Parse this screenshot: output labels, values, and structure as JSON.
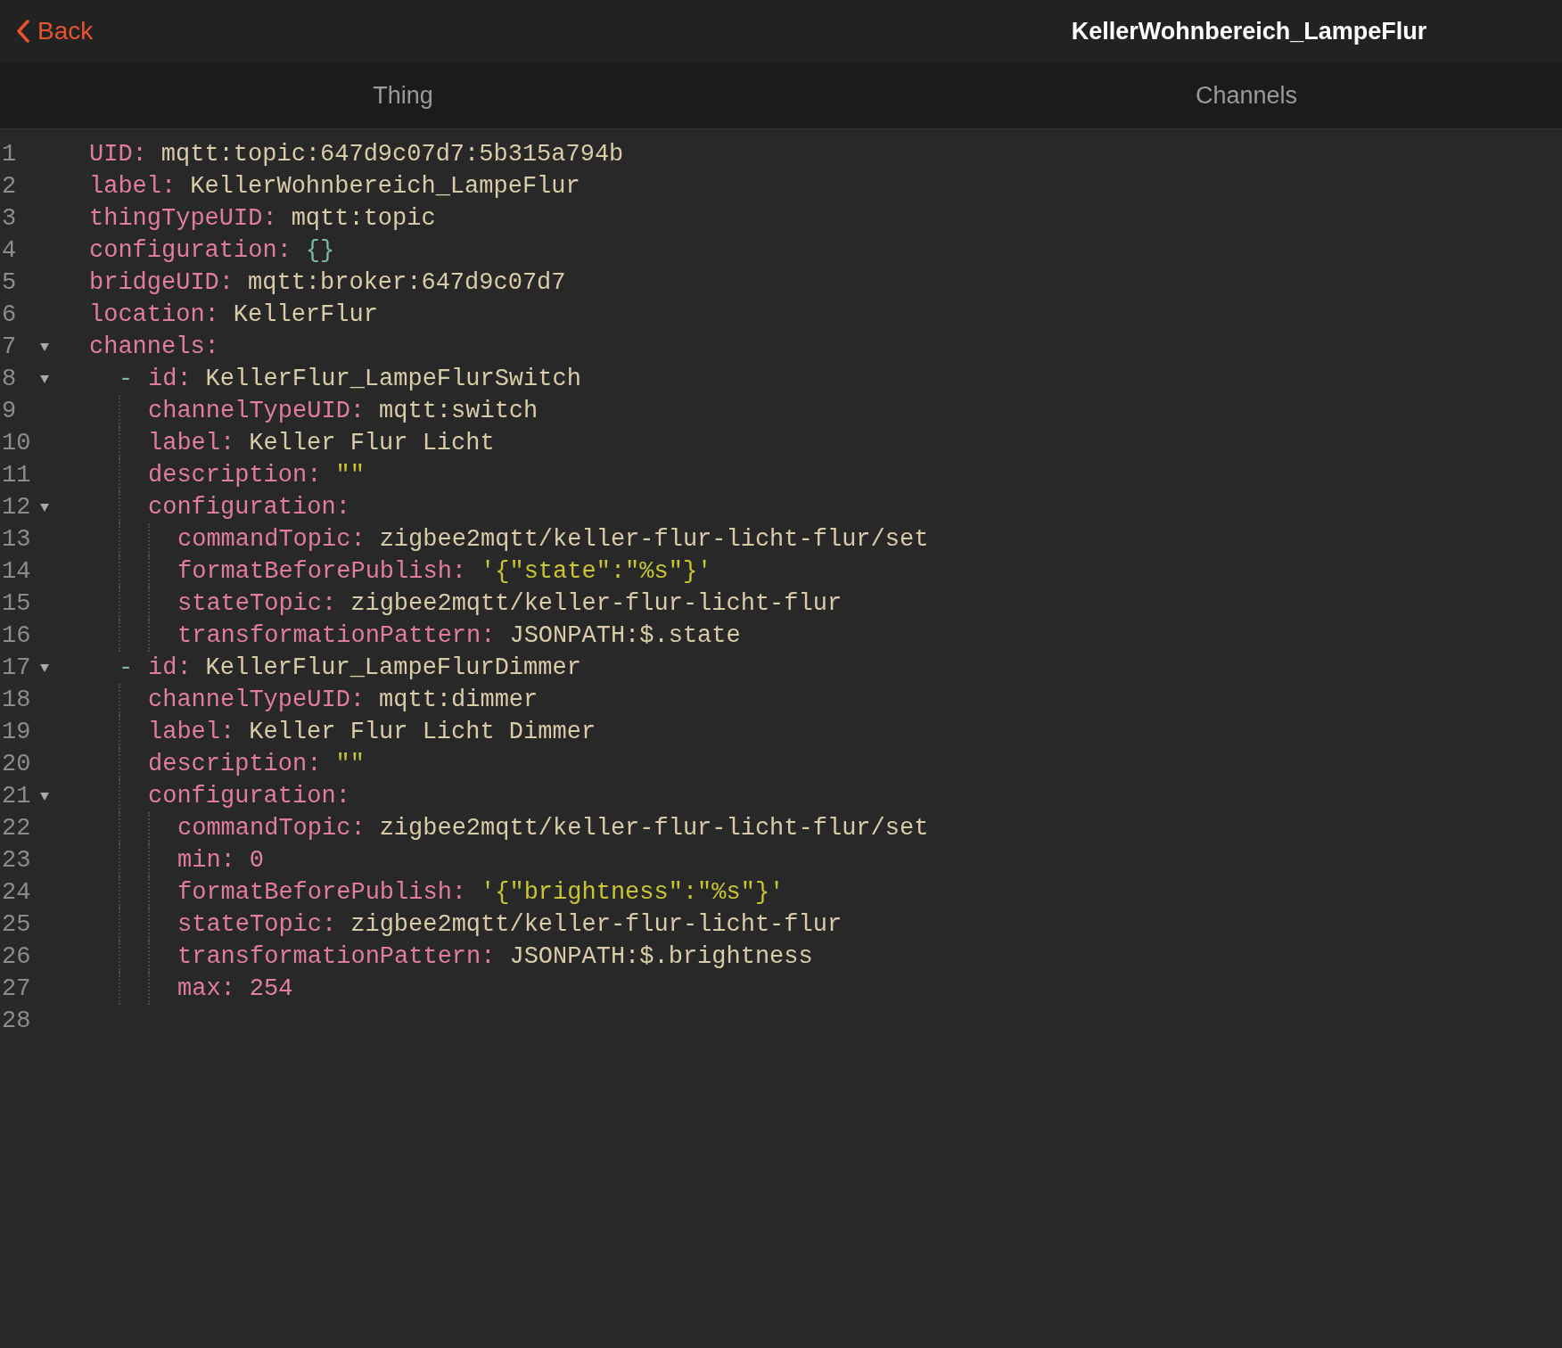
{
  "nav": {
    "back": "Back",
    "title": "KellerWohnbereich_LampeFlur"
  },
  "tabs": [
    {
      "label": "Thing"
    },
    {
      "label": "Channels"
    }
  ],
  "editor": {
    "lines": [
      {
        "number": "1",
        "key": "UID:",
        "value": "mqtt:topic:647d9c07d7:5b315a794b",
        "kind": "plain"
      },
      {
        "number": "2",
        "key": "label:",
        "value": "KellerWohnbereich_LampeFlur",
        "kind": "plain"
      },
      {
        "number": "3",
        "key": "thingTypeUID:",
        "value": "mqtt:topic",
        "kind": "plain"
      },
      {
        "number": "4",
        "key": "configuration:",
        "value": "{}",
        "kind": "brace"
      },
      {
        "number": "5",
        "key": "bridgeUID:",
        "value": "mqtt:broker:647d9c07d7",
        "kind": "plain"
      },
      {
        "number": "6",
        "key": "location:",
        "value": "KellerFlur",
        "kind": "plain"
      },
      {
        "number": "7",
        "key": "channels:",
        "expanded": true,
        "children": [
          {
            "number": "8",
            "marker": "-",
            "key": "id:",
            "value": "KellerFlur_LampeFlurSwitch",
            "kind": "plain",
            "expanded": true,
            "children": [
              {
                "number": "9",
                "key": "channelTypeUID:",
                "value": "mqtt:switch",
                "kind": "plain"
              },
              {
                "number": "10",
                "key": "label:",
                "value": "Keller Flur Licht",
                "kind": "plain"
              },
              {
                "number": "11",
                "key": "description:",
                "value": "\"\"",
                "kind": "string"
              },
              {
                "number": "12",
                "key": "configuration:",
                "expanded": true,
                "children": [
                  {
                    "number": "13",
                    "key": "commandTopic:",
                    "value": "zigbee2mqtt/keller-flur-licht-flur/set",
                    "kind": "plain"
                  },
                  {
                    "number": "14",
                    "key": "formatBeforePublish:",
                    "value": "'{\"state\":\"%s\"}'",
                    "kind": "string"
                  },
                  {
                    "number": "15",
                    "key": "stateTopic:",
                    "value": "zigbee2mqtt/keller-flur-licht-flur",
                    "kind": "plain"
                  },
                  {
                    "number": "16",
                    "key": "transformationPattern:",
                    "value": "JSONPATH:$.state",
                    "kind": "plain"
                  }
                ]
              }
            ]
          },
          {
            "number": "17",
            "marker": "-",
            "key": "id:",
            "value": "KellerFlur_LampeFlurDimmer",
            "kind": "plain",
            "expanded": true,
            "children": [
              {
                "number": "18",
                "key": "channelTypeUID:",
                "value": "mqtt:dimmer",
                "kind": "plain"
              },
              {
                "number": "19",
                "key": "label:",
                "value": "Keller Flur Licht Dimmer",
                "kind": "plain"
              },
              {
                "number": "20",
                "key": "description:",
                "value": "\"\"",
                "kind": "string"
              },
              {
                "number": "21",
                "key": "configuration:",
                "expanded": true,
                "children": [
                  {
                    "number": "22",
                    "key": "commandTopic:",
                    "value": "zigbee2mqtt/keller-flur-licht-flur/set",
                    "kind": "plain"
                  },
                  {
                    "number": "23",
                    "key": "min:",
                    "value": "0",
                    "kind": "number"
                  },
                  {
                    "number": "24",
                    "key": "formatBeforePublish:",
                    "value": "'{\"brightness\":\"%s\"}'",
                    "kind": "string"
                  },
                  {
                    "number": "25",
                    "key": "stateTopic:",
                    "value": "zigbee2mqtt/keller-flur-licht-flur",
                    "kind": "plain"
                  },
                  {
                    "number": "26",
                    "key": "transformationPattern:",
                    "value": "JSONPATH:$.brightness",
                    "kind": "plain"
                  },
                  {
                    "number": "27",
                    "key": "max:",
                    "value": "254",
                    "kind": "number"
                  }
                ]
              }
            ]
          }
        ]
      },
      {
        "number": "28"
      }
    ]
  }
}
